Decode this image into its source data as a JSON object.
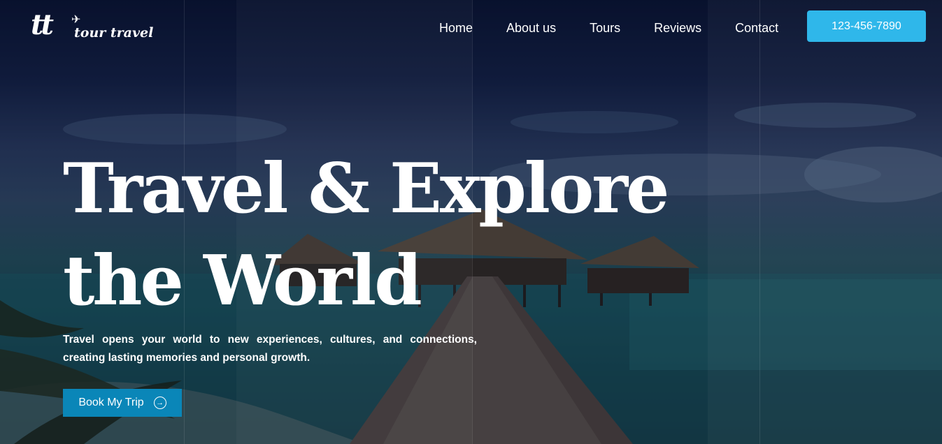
{
  "brand": {
    "logo_mark": "tt",
    "logo_text": "tour travel",
    "plane_icon": "airplane-icon"
  },
  "nav": {
    "items": [
      {
        "label": "Home"
      },
      {
        "label": "About us"
      },
      {
        "label": "Tours"
      },
      {
        "label": "Reviews"
      },
      {
        "label": "Contact"
      }
    ],
    "phone_label": "123-456-7890"
  },
  "hero": {
    "title_line1": "Travel & Explore",
    "title_line2": "the World",
    "description": "Travel opens your world to new experiences, cultures, and connections, creating lasting memories and personal growth.",
    "cta_label": "Book My Trip",
    "cta_icon": "arrow-right-circle-icon"
  },
  "colors": {
    "accent": "#2fb7ea",
    "cta": "#0a86b8",
    "text": "#ffffff"
  }
}
